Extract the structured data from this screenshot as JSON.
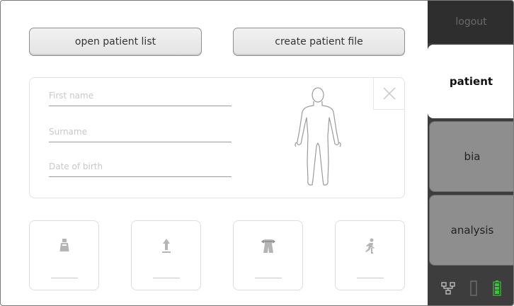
{
  "actions": {
    "open_patient_list": "open patient list",
    "create_patient_file": "create patient file"
  },
  "patient_form": {
    "first_name_placeholder": "First name",
    "surname_placeholder": "Surname",
    "date_of_birth_placeholder": "Date of birth",
    "close_icon": "close-icon",
    "figure_icon": "body-outline-icon"
  },
  "measurement_tiles": [
    {
      "icon": "weight-icon",
      "value": ""
    },
    {
      "icon": "height-icon",
      "value": ""
    },
    {
      "icon": "waist-icon",
      "value": ""
    },
    {
      "icon": "activity-icon",
      "value": ""
    }
  ],
  "sidebar": {
    "logout": "logout",
    "tabs": [
      "patient",
      "bia",
      "analysis"
    ],
    "active_tab": "patient",
    "status_icons": [
      "network-icon",
      "device-icon",
      "battery-icon"
    ]
  },
  "colors": {
    "sidebar_bg": "#3d3d3d",
    "tab_inactive": "#8e8e8e",
    "tab_active": "#ffffff",
    "battery_green": "#3cc23c",
    "placeholder_text": "#c8c8c8"
  }
}
